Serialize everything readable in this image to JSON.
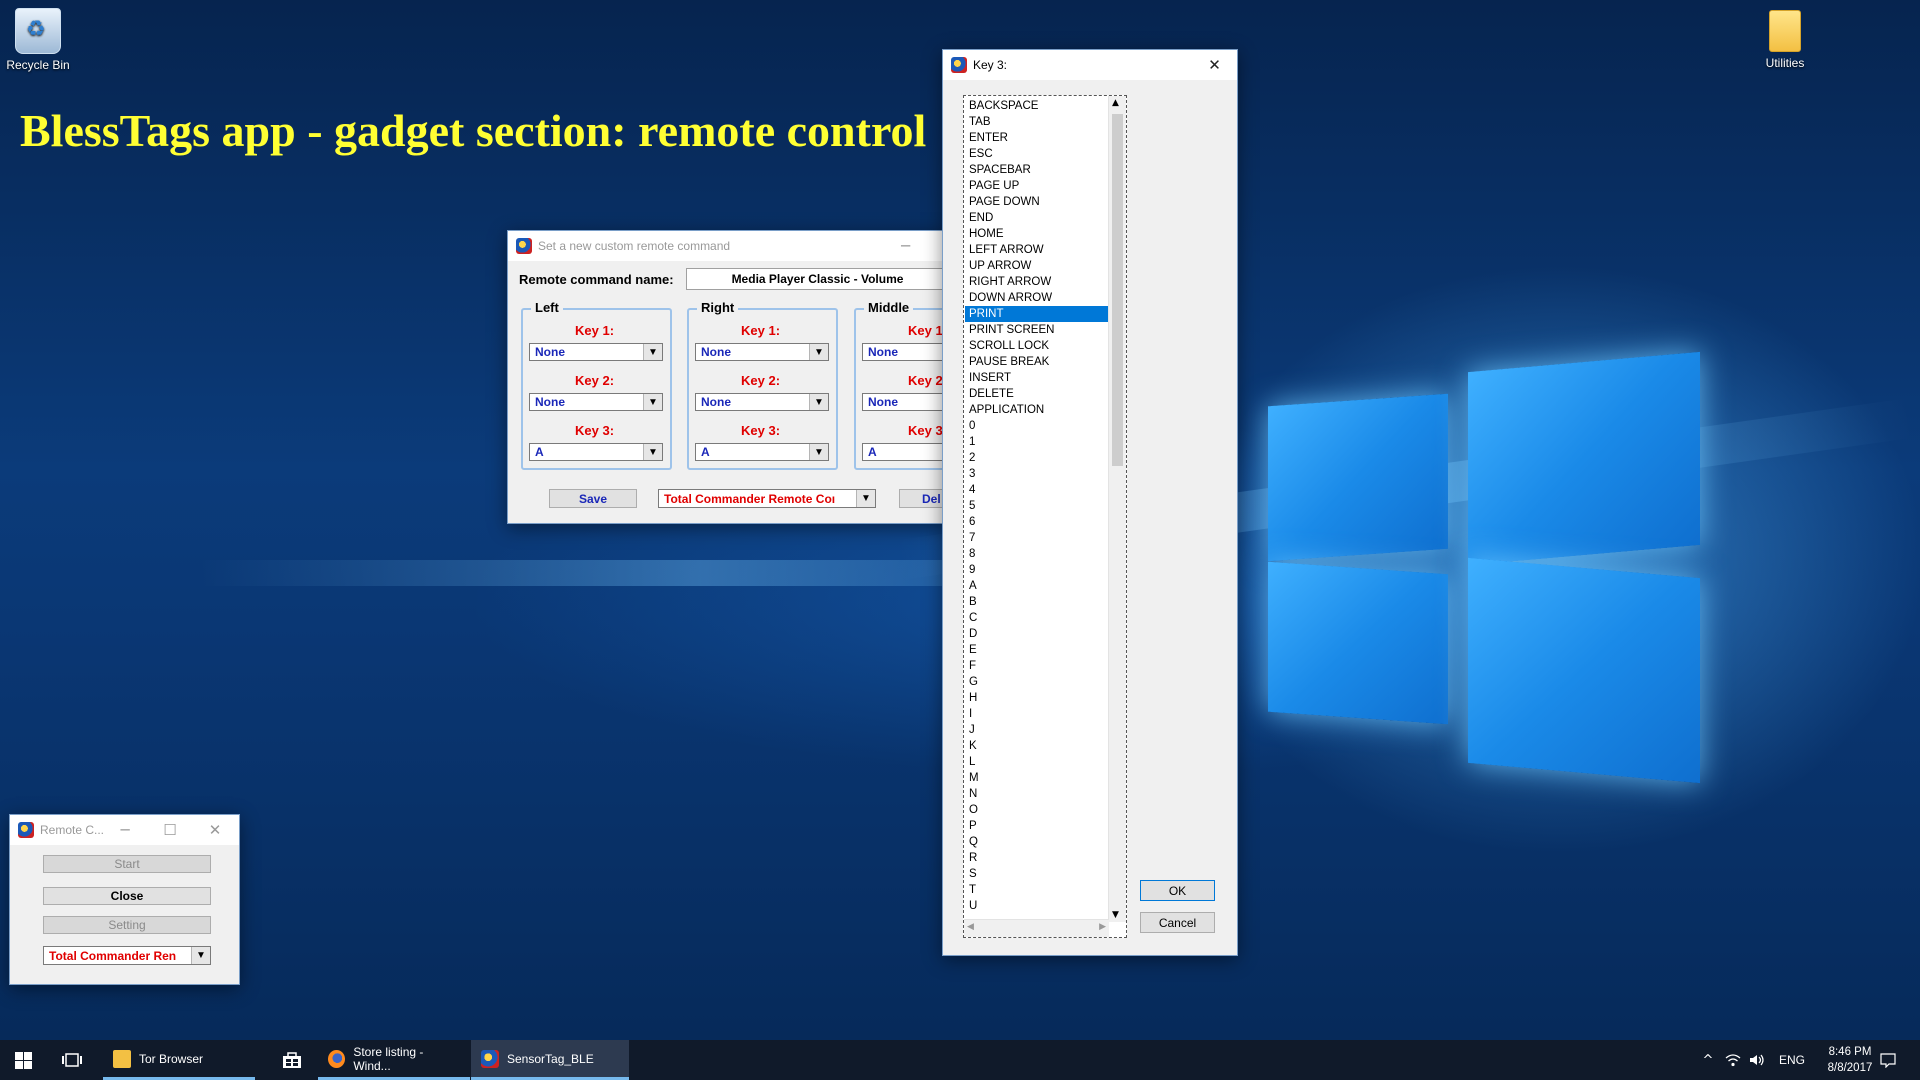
{
  "desktop": {
    "headline": "BlessTags app - gadget section: remote control",
    "icons": [
      {
        "label": "Recycle Bin",
        "icon": "recycle-bin-icon"
      },
      {
        "label": "Utilities",
        "icon": "folder-icon"
      }
    ]
  },
  "custom_window": {
    "title": "Set a new custom remote command",
    "minimize": "─",
    "name_label": "Remote command name:",
    "name_value": "Media Player Classic - Volume",
    "groups": [
      {
        "title": "Left",
        "keys": [
          {
            "label": "Key 1:",
            "value": "None"
          },
          {
            "label": "Key 2:",
            "value": "None"
          },
          {
            "label": "Key 3:",
            "value": "A"
          }
        ]
      },
      {
        "title": "Right",
        "keys": [
          {
            "label": "Key 1:",
            "value": "None"
          },
          {
            "label": "Key 2:",
            "value": "None"
          },
          {
            "label": "Key 3:",
            "value": "A"
          }
        ]
      },
      {
        "title": "Middle",
        "keys": [
          {
            "label": "Key 1",
            "value": "None"
          },
          {
            "label": "Key 2",
            "value": "None"
          },
          {
            "label": "Key 3",
            "value": "A"
          }
        ]
      }
    ],
    "save_label": "Save",
    "preset_value": "Total Commander Remote Coı",
    "delete_label": "Del"
  },
  "key_dialog": {
    "title": "Key 3:",
    "close": "✕",
    "selected": "PRINT",
    "items": [
      "BACKSPACE",
      "TAB",
      "ENTER",
      "ESC",
      "SPACEBAR",
      "PAGE UP",
      "PAGE DOWN",
      "END",
      "HOME",
      "LEFT ARROW",
      "UP ARROW",
      "RIGHT ARROW",
      "DOWN ARROW",
      "PRINT",
      "PRINT SCREEN",
      "SCROLL LOCK",
      "PAUSE BREAK",
      "INSERT",
      "DELETE",
      "APPLICATION",
      "0",
      "1",
      "2",
      "3",
      "4",
      "5",
      "6",
      "7",
      "8",
      "9",
      "A",
      "B",
      "C",
      "D",
      "E",
      "F",
      "G",
      "H",
      "I",
      "J",
      "K",
      "L",
      "M",
      "N",
      "O",
      "P",
      "Q",
      "R",
      "S",
      "T",
      "U"
    ],
    "ok_label": "OK",
    "cancel_label": "Cancel"
  },
  "remote_window": {
    "title": "Remote C...",
    "minimize": "─",
    "maximize": "☐",
    "close": "✕",
    "start_label": "Start",
    "close_label": "Close",
    "setting_label": "Setting",
    "preset_value": "Total Commander Ren"
  },
  "taskbar": {
    "apps": [
      {
        "label": "Tor Browser",
        "icon": "folder-icon"
      },
      {
        "label": "",
        "icon": "store-icon"
      },
      {
        "label": "Store listing - Wind...",
        "icon": "firefox-icon"
      },
      {
        "label": "SensorTag_BLE",
        "icon": "sensortag-icon"
      }
    ],
    "lang": "ENG",
    "time": "8:46 PM",
    "date": "8/8/2017"
  },
  "colors": {
    "accent": "#0078d7",
    "headline": "#ffff33",
    "key_label": "#e00000",
    "combo_text": "#1a27b8"
  }
}
